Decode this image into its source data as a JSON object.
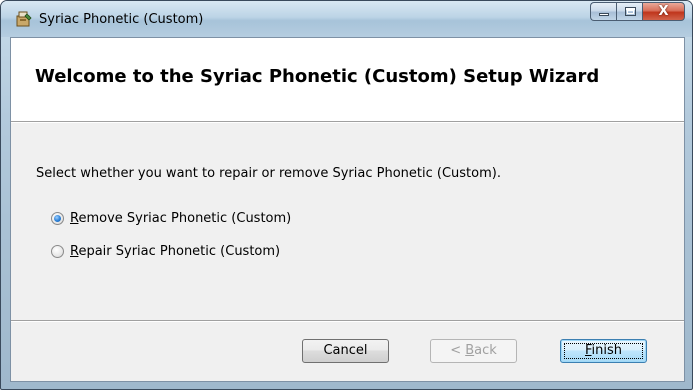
{
  "window": {
    "title": "Syriac Phonetic (Custom)",
    "icon": "installer-icon",
    "close_glyph": "X"
  },
  "banner": {
    "title": "Welcome to the Syriac Phonetic (Custom) Setup Wizard"
  },
  "body": {
    "instruction": "Select whether you want to repair or remove Syriac Phonetic (Custom).",
    "options": [
      {
        "accel": "R",
        "rest": "emove Syriac Phonetic (Custom)",
        "selected": true
      },
      {
        "accel": "R",
        "rest": "epair Syriac Phonetic (Custom)",
        "selected": false
      }
    ]
  },
  "buttons": {
    "cancel": "Cancel",
    "back_prefix": "< ",
    "back_accel": "B",
    "back_rest": "ack",
    "back_enabled": false,
    "finish_accel": "F",
    "finish_rest": "inish"
  },
  "colors": {
    "title_bar": "#bcd4e6",
    "client_bg": "#f0f0f0",
    "banner_bg": "#ffffff",
    "close_button": "#c0351c",
    "radio_accent": "#2a7fd6",
    "default_button_border": "#3c7fb1"
  }
}
